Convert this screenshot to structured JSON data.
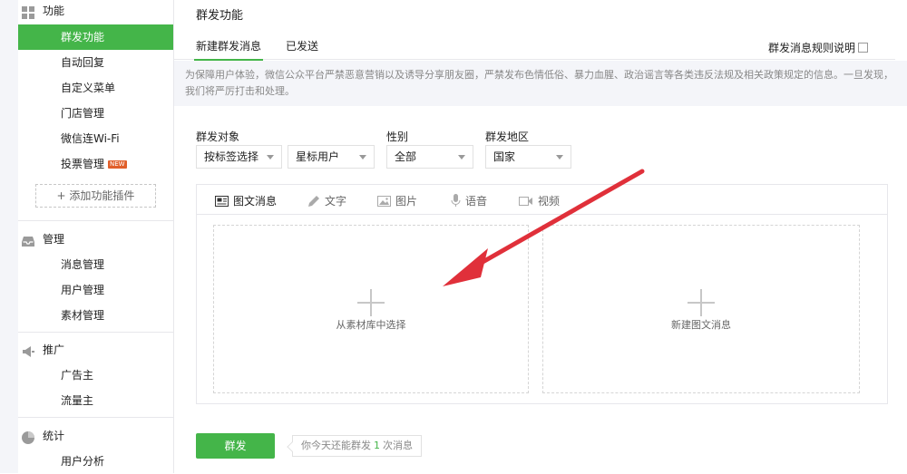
{
  "sidebar": {
    "sections": [
      {
        "head": "功能",
        "icon": "grid-icon",
        "items": [
          {
            "label": "群发功能",
            "active": true
          },
          {
            "label": "自动回复"
          },
          {
            "label": "自定义菜单"
          },
          {
            "label": "门店管理"
          },
          {
            "label": "微信连Wi-Fi"
          },
          {
            "label": "投票管理",
            "badge": "NEW"
          }
        ],
        "add_plugin": "添加功能插件"
      },
      {
        "head": "管理",
        "icon": "inbox-icon",
        "items": [
          {
            "label": "消息管理"
          },
          {
            "label": "用户管理"
          },
          {
            "label": "素材管理"
          }
        ]
      },
      {
        "head": "推广",
        "icon": "megaphone-icon",
        "items": [
          {
            "label": "广告主"
          },
          {
            "label": "流量主"
          }
        ]
      },
      {
        "head": "统计",
        "icon": "pie-chart-icon",
        "items": [
          {
            "label": "用户分析"
          }
        ]
      }
    ]
  },
  "main": {
    "title": "群发功能",
    "tabs": [
      {
        "label": "新建群发消息",
        "active": true
      },
      {
        "label": "已发送"
      }
    ],
    "rules_link": "群发消息规则说明",
    "notice": "为保障用户体验，微信公众平台严禁恶意营销以及诱导分享朋友圈，严禁发布色情低俗、暴力血腥、政治谣言等各类违反法规及相关政策规定的信息。一旦发现，我们将严厉打击和处理。",
    "filters": {
      "target_label": "群发对象",
      "target_value": "按标签选择",
      "tag_value": "星标用户",
      "gender_label": "性别",
      "gender_value": "全部",
      "region_label": "群发地区",
      "region_value": "国家"
    },
    "editor_tabs": [
      {
        "label": "图文消息",
        "icon": "article-icon",
        "active": true
      },
      {
        "label": "文字",
        "icon": "pencil-icon"
      },
      {
        "label": "图片",
        "icon": "image-icon"
      },
      {
        "label": "语音",
        "icon": "microphone-icon"
      },
      {
        "label": "视频",
        "icon": "video-icon"
      }
    ],
    "drop_left": "从素材库中选择",
    "drop_right": "新建图文消息",
    "send_button": "群发",
    "quota_prefix": "你今天还能群发",
    "quota_count": "1",
    "quota_suffix": "次消息"
  },
  "colors": {
    "accent": "#44b549",
    "annotation_arrow": "#e0303a"
  }
}
